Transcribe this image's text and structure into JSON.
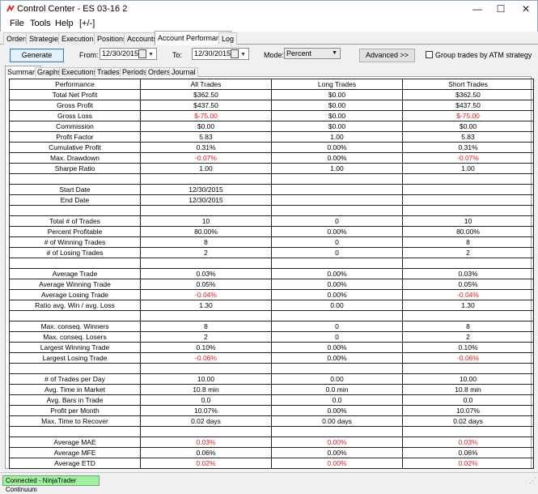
{
  "window": {
    "title": "Control Center - ES 03-16 2",
    "minimize": "—",
    "maximize": "☐",
    "close": "✕"
  },
  "menu": [
    "File",
    "Tools",
    "Help",
    "[+/-]"
  ],
  "main_tabs": [
    "Orders",
    "Strategies",
    "Executions",
    "Positions",
    "Accounts",
    "Account Performance",
    "Log"
  ],
  "toolbar": {
    "generate": "Generate",
    "from_label": "From:",
    "from_value": "12/30/2015",
    "to_label": "To:",
    "to_value": "12/30/2015",
    "mode_label": "Mode:",
    "mode_value": "Percent",
    "advanced": "Advanced >>",
    "group_label": "Group trades by ATM strategy"
  },
  "sub_tabs": [
    "Summary",
    "Graphs",
    "Executions",
    "Trades",
    "Periods",
    "Orders",
    "Journal"
  ],
  "table": {
    "headers": [
      "Performance",
      "All Trades",
      "Long Trades",
      "Short Trades"
    ],
    "rows": [
      [
        "Total Net Profit",
        "$362.50",
        "$0.00",
        "$362.50"
      ],
      [
        "Gross Profit",
        "$437.50",
        "$0.00",
        "$437.50"
      ],
      [
        "Gross Loss",
        "$-75.00",
        "$0.00",
        "$-75.00"
      ],
      [
        "Commission",
        "$0.00",
        "$0.00",
        "$0.00"
      ],
      [
        "Profit Factor",
        "5.83",
        "1.00",
        "5.83"
      ],
      [
        "Cumulative Profit",
        "0.31%",
        "0.00%",
        "0.31%"
      ],
      [
        "Max. Drawdown",
        "-0.07%",
        "0.00%",
        "-0.07%"
      ],
      [
        "Sharpe Ratio",
        "1.00",
        "1.00",
        "1.00"
      ],
      [
        "",
        "",
        "",
        ""
      ],
      [
        "Start Date",
        "12/30/2015",
        "",
        ""
      ],
      [
        "End Date",
        "12/30/2015",
        "",
        ""
      ],
      [
        "",
        "",
        "",
        ""
      ],
      [
        "Total # of Trades",
        "10",
        "0",
        "10"
      ],
      [
        "Percent Profitable",
        "80.00%",
        "0.00%",
        "80.00%"
      ],
      [
        "# of Winning Trades",
        "8",
        "0",
        "8"
      ],
      [
        "# of Losing Trades",
        "2",
        "0",
        "2"
      ],
      [
        "",
        "",
        "",
        ""
      ],
      [
        "Average Trade",
        "0.03%",
        "0.00%",
        "0.03%"
      ],
      [
        "Average Winning Trade",
        "0.05%",
        "0.00%",
        "0.05%"
      ],
      [
        "Average Losing Trade",
        "-0.04%",
        "0.00%",
        "-0.04%"
      ],
      [
        "Ratio avg. Win / avg. Loss",
        "1.30",
        "0.00",
        "1.30"
      ],
      [
        "",
        "",
        "",
        ""
      ],
      [
        "Max. conseq. Winners",
        "8",
        "0",
        "8"
      ],
      [
        "Max. conseq. Losers",
        "2",
        "0",
        "2"
      ],
      [
        "Largest Winning Trade",
        "0.10%",
        "0.00%",
        "0.10%"
      ],
      [
        "Largest Losing Trade",
        "-0.06%",
        "0.00%",
        "-0.06%"
      ],
      [
        "",
        "",
        "",
        ""
      ],
      [
        "# of Trades per Day",
        "10.00",
        "0.00",
        "10.00"
      ],
      [
        "Avg. Time in Market",
        "10.8 min",
        "0.0 min",
        "10.8 min"
      ],
      [
        "Avg. Bars in Trade",
        "0.0",
        "0.0",
        "0.0"
      ],
      [
        "Profit per Month",
        "10.07%",
        "0.00%",
        "10.07%"
      ],
      [
        "Max. Time to Recover",
        "0.02 days",
        "0.00 days",
        "0.02 days"
      ],
      [
        "",
        "",
        "",
        ""
      ],
      [
        "Average MAE",
        "0.03%",
        "0.00%",
        "0.03%"
      ],
      [
        "Average MFE",
        "0.06%",
        "0.00%",
        "0.06%"
      ],
      [
        "Average ETD",
        "0.02%",
        "0.00%",
        "0.02%"
      ]
    ],
    "red_cells": [
      [
        2,
        1
      ],
      [
        2,
        3
      ],
      [
        6,
        1
      ],
      [
        6,
        3
      ],
      [
        19,
        1
      ],
      [
        19,
        3
      ],
      [
        25,
        1
      ],
      [
        25,
        3
      ],
      [
        33,
        1
      ],
      [
        33,
        2
      ],
      [
        33,
        3
      ],
      [
        35,
        1
      ],
      [
        35,
        2
      ],
      [
        35,
        3
      ]
    ]
  },
  "status": {
    "connection": "Connected - NinjaTrader Continuum",
    "connection_color": "#9ff09f"
  },
  "colors": {
    "negative": "#e02020",
    "generate_border": "#3c7fb1"
  }
}
